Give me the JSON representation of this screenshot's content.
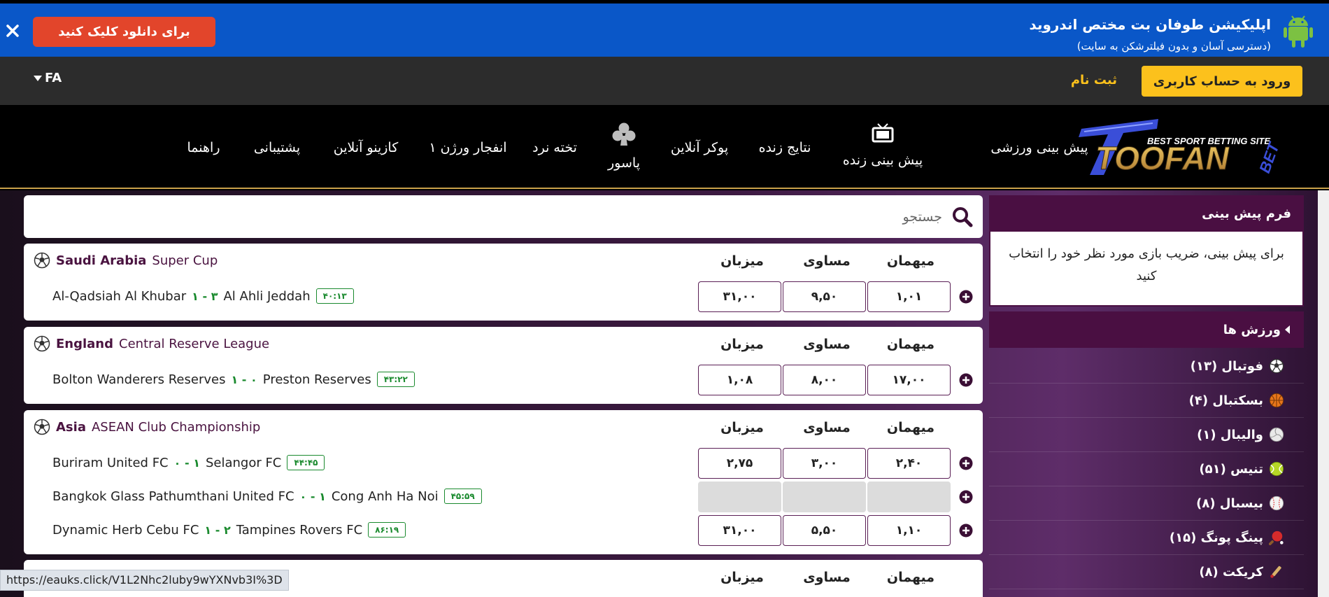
{
  "banner": {
    "title": "اپلیکیشن طوفان بت مختص اندروید",
    "subtitle": "(دسترسی آسان و بدون فیلترشکن به سایت)",
    "download_label": "برای دانلود کلیک کنید",
    "close_label": "×"
  },
  "account": {
    "login_label": "ورود به حساب کاربری",
    "register_label": "ثبت نام",
    "language": "FA"
  },
  "nav": {
    "logo_tagline": "BEST SPORT BETTING SITE",
    "logo_text": "TOOFAN",
    "logo_suffix": "BET",
    "items": [
      {
        "label": "پیش بینی ورزشی"
      },
      {
        "label": "پیش بینی زنده",
        "icon": "tv-icon"
      },
      {
        "label": "نتایج زنده"
      },
      {
        "label": "پوکر آنلاین"
      },
      {
        "label": "پاسور",
        "icon": "club-icon"
      },
      {
        "label": "تخته نرد"
      },
      {
        "label": "انفجار ورژن ۱"
      },
      {
        "label": "کازینو آنلاین"
      },
      {
        "label": "پشتیبانی"
      },
      {
        "label": "راهنما"
      }
    ]
  },
  "search": {
    "placeholder": "جستجو"
  },
  "odds_headers": {
    "away": "میهمان",
    "draw": "مساوی",
    "home": "میزبان"
  },
  "leagues": [
    {
      "country": "Saudi Arabia",
      "league": "Super Cup",
      "matches": [
        {
          "home": "Al-Qadsiah Al Khubar",
          "score": "۱ - ۳",
          "away": "Al Ahli Jeddah",
          "time": "۴۰:۱۳",
          "odds": {
            "home": "۳۱,۰۰",
            "draw": "۹,۵۰",
            "away": "۱,۰۱"
          }
        }
      ]
    },
    {
      "country": "England",
      "league": "Central Reserve League",
      "matches": [
        {
          "home": "Bolton Wanderers Reserves",
          "score": "۱ - ۰",
          "away": "Preston Reserves",
          "time": "۴۳:۲۲",
          "odds": {
            "home": "۱,۰۸",
            "draw": "۸,۰۰",
            "away": "۱۷,۰۰"
          }
        }
      ]
    },
    {
      "country": "Asia",
      "league": "ASEAN Club Championship",
      "matches": [
        {
          "home": "Buriram United FC",
          "score": "۰ - ۱",
          "away": "Selangor FC",
          "time": "۴۴:۴۵",
          "odds": {
            "home": "۲,۷۵",
            "draw": "۳,۰۰",
            "away": "۲,۴۰"
          }
        },
        {
          "home": "Bangkok Glass Pathumthani United FC",
          "score": "۰ - ۱",
          "away": "Cong Anh Ha Noi",
          "time": "۴۵:۵۹",
          "odds": {
            "home": "",
            "draw": "",
            "away": ""
          },
          "locked": true
        },
        {
          "home": "Dynamic Herb Cebu FC",
          "score": "۱ - ۲",
          "away": "Tampines Rovers FC",
          "time": "۸۶:۱۹",
          "odds": {
            "home": "۳۱,۰۰",
            "draw": "۵,۵۰",
            "away": "۱,۱۰"
          }
        }
      ]
    }
  ],
  "sidebar": {
    "bet_form_title": "فرم پیش بینی",
    "bet_form_message": "برای پیش بینی، ضریب بازی مورد نظر خود را انتخاب کنید",
    "sports_title": "ورزش ها",
    "sports": [
      {
        "label": "فوتبال (۱۳)",
        "icon": "soccer-ball-icon"
      },
      {
        "label": "بسکتبال (۴)",
        "icon": "basketball-icon"
      },
      {
        "label": "والیبال (۱)",
        "icon": "volleyball-icon"
      },
      {
        "label": "تنیس (۵۱)",
        "icon": "tennis-ball-icon"
      },
      {
        "label": "بیسبال (۸)",
        "icon": "baseball-icon"
      },
      {
        "label": "پینگ پونگ (۱۵)",
        "icon": "ping-pong-icon"
      },
      {
        "label": "کریکت (۸)",
        "icon": "cricket-icon"
      }
    ]
  },
  "status_bar": {
    "url": "https://eauks.click/V1L2Nhc2luby9wYXNvb3I%3D"
  },
  "colors": {
    "banner": "#0a57c8",
    "download": "#e2452b",
    "login": "#fcc11c",
    "purple": "#4a0f42",
    "score_green": "#1a8a2e"
  }
}
